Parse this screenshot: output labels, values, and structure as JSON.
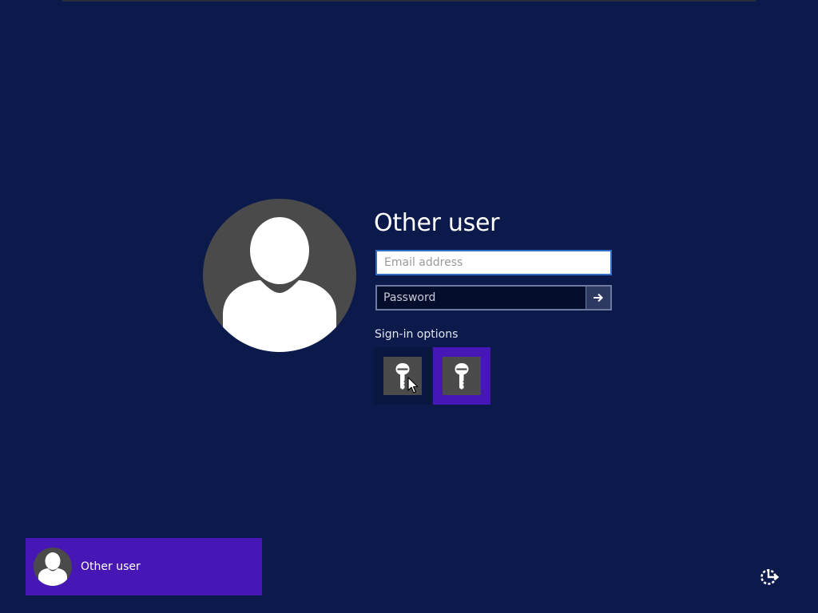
{
  "login": {
    "title": "Other user",
    "email_placeholder": "Email address",
    "email_value": "",
    "password_placeholder": "Password",
    "password_value": "",
    "signin_options_label": "Sign-in options",
    "options": [
      {
        "icon": "key-icon",
        "selected": false
      },
      {
        "icon": "key-icon",
        "selected": true
      }
    ]
  },
  "user_tiles": [
    {
      "name": "Other user",
      "icon": "user-icon",
      "selected": true
    }
  ],
  "accessibility": {
    "icon": "ease-of-access-icon"
  },
  "colors": {
    "background": "#0b1a4a",
    "accent": "#4617b4",
    "email_border": "#2f6fc9",
    "avatar": "#4a4a4a"
  }
}
